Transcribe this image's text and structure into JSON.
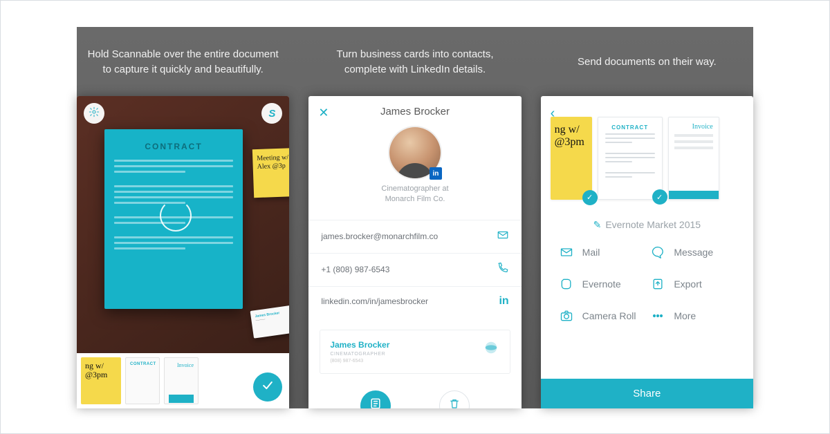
{
  "accent": "#1fb1c6",
  "panel1": {
    "caption": "Hold Scannable over the entire document to capture it quickly and beautifully.",
    "doc_title": "CONTRACT",
    "sticky_line1": "Meeting w/",
    "sticky_line2": "Alex @3p",
    "bizcard_name": "James Brocker",
    "thumbs": {
      "sticky_line1": "ng w/",
      "sticky_line2": "@3pm",
      "contract_title": "CONTRACT",
      "invoice_title": "Invoice"
    }
  },
  "panel2": {
    "caption": "Turn business cards into contacts, complete with LinkedIn details.",
    "name": "James Brocker",
    "subtitle_line1": "Cinematographer at",
    "subtitle_line2": "Monarch Film Co.",
    "email": "james.brocker@monarchfilm.co",
    "phone": "+1 (808) 987-6543",
    "linkedin": "linkedin.com/in/jamesbrocker",
    "card_name": "James Brocker",
    "card_job": "CINEMATOGRAPHER",
    "card_phone": "(808) 987-6543",
    "linkedin_badge": "in"
  },
  "panel3": {
    "caption": "Send documents on their way.",
    "thumbs": {
      "sticky_line1": "ng w/",
      "sticky_line2": "@3pm",
      "contract_title": "CONTRACT",
      "invoice_title": "Invoice"
    },
    "collection_name": "Evernote Market 2015",
    "share": {
      "mail": "Mail",
      "message": "Message",
      "evernote": "Evernote",
      "export": "Export",
      "camera_roll": "Camera Roll",
      "more": "More"
    },
    "share_button": "Share"
  }
}
